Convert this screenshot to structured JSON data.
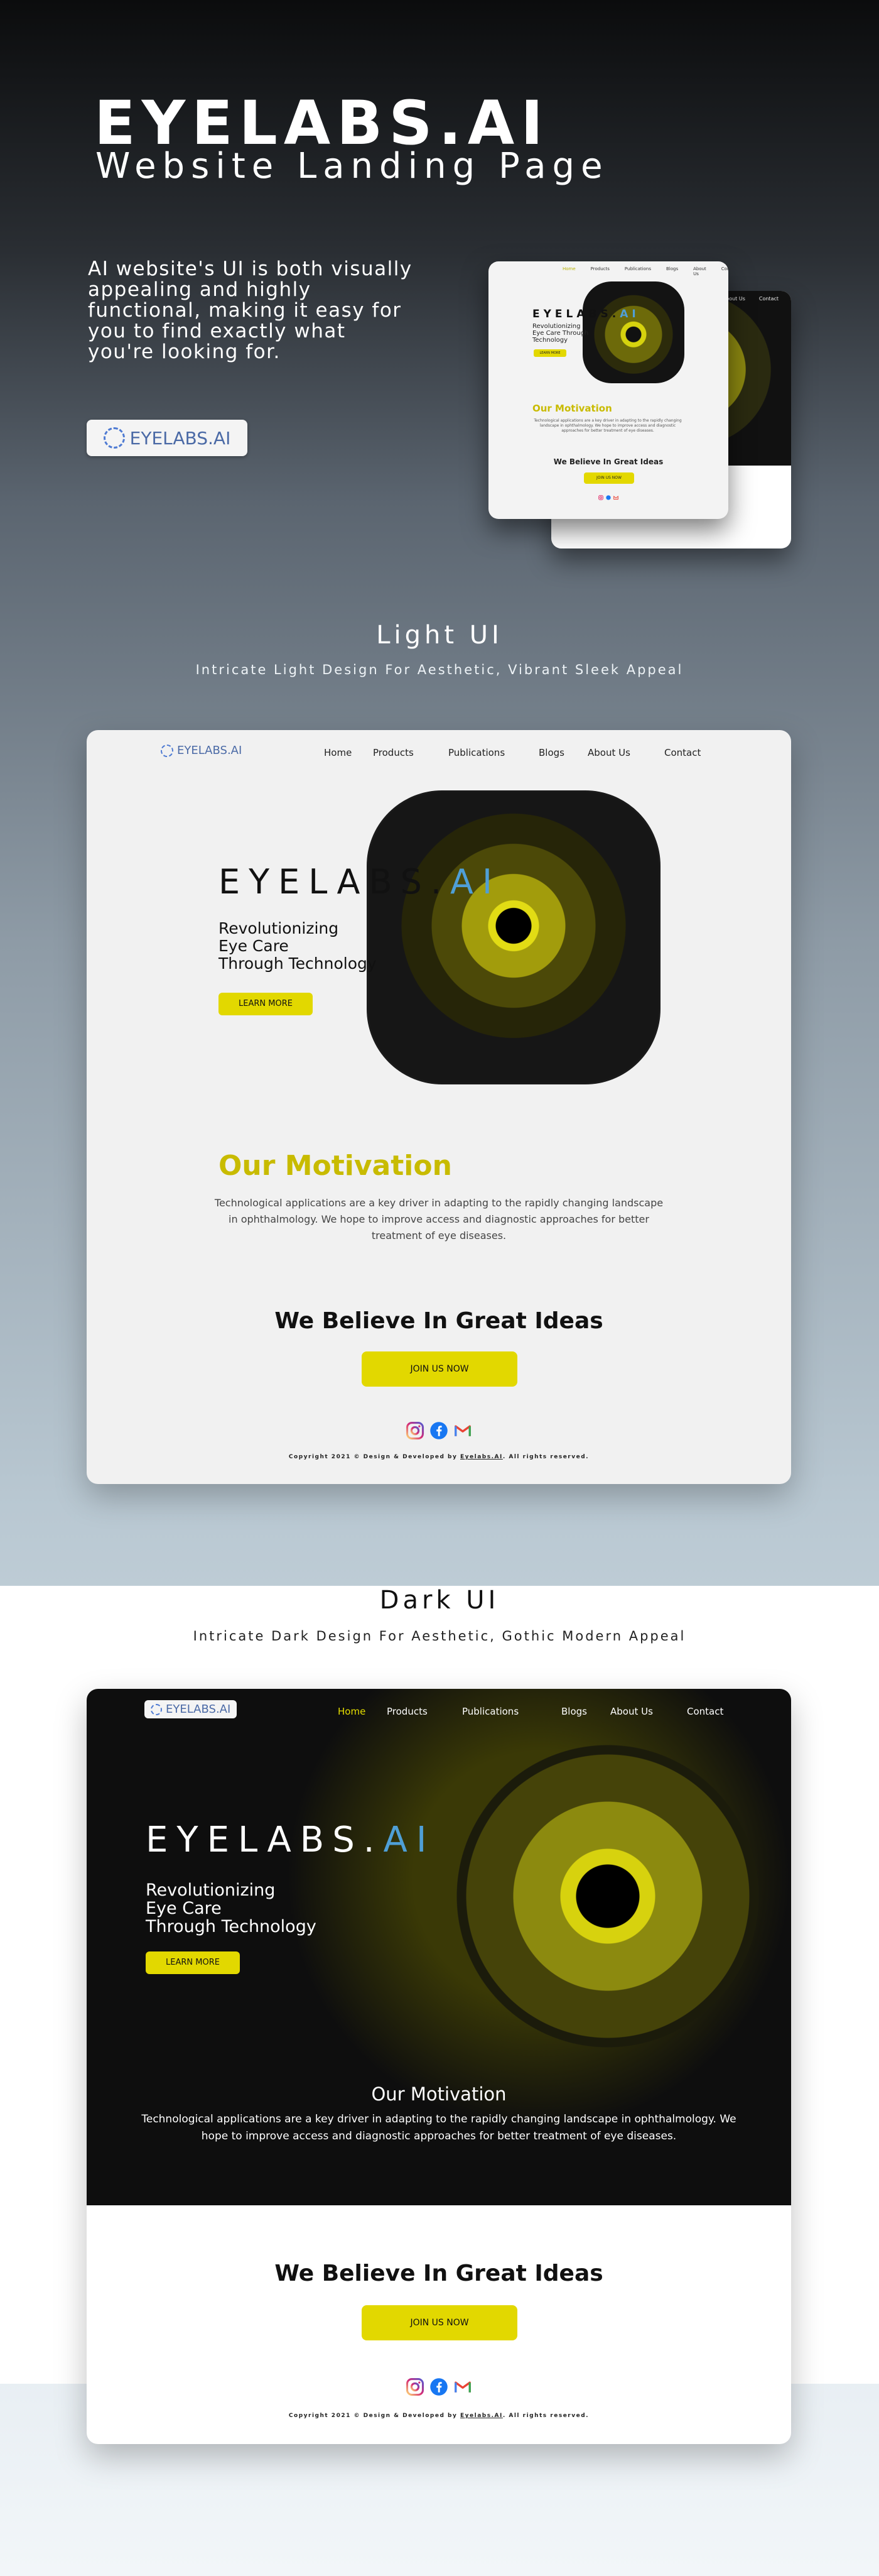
{
  "hero": {
    "title": "EYELABS.AI",
    "subtitle": "Website Landing Page",
    "description": "AI website's UI is both visually appealing and highly functional, making it easy for you to find exactly what you're looking for.",
    "logo_text": "EYELABS.AI"
  },
  "mockup": {
    "nav": [
      "Home",
      "Products",
      "Publications",
      "Blogs",
      "About Us",
      "Contact"
    ],
    "brand_main": "EYELABS.",
    "brand_ai": "AI",
    "tagline": "Revolutionizing Eye Care Through Technology",
    "learn_more": "LEARN MORE",
    "motivation": "Our Motivation",
    "motivation_text": "Technological applications are a key driver in adapting to the rapidly changing landscape in ophthalmology. We hope to improve access and diagnostic approaches for better treatment of eye diseases.",
    "ideas": "We Believe In Great Ideas",
    "join": "JOIN US NOW"
  },
  "light_section": {
    "title": "Light UI",
    "subtitle": "Intricate Light Design For Aesthetic, Vibrant Sleek Appeal"
  },
  "dark_section": {
    "title": "Dark UI",
    "subtitle": "Intricate Dark Design For Aesthetic, Gothic Modern Appeal"
  },
  "site": {
    "logo": "EYELABS.AI",
    "nav": {
      "home": "Home",
      "products": "Products",
      "publications": "Publications",
      "blogs": "Blogs",
      "about": "About Us",
      "contact": "Contact"
    },
    "brand_main": "EYELABS.",
    "brand_ai": "AI",
    "tagline_1": "Revolutionizing",
    "tagline_2": "Eye Care",
    "tagline_3": "Through Technology",
    "learn_more": "LEARN MORE",
    "motivation_title": "Our Motivation",
    "motivation_text": "Technological applications are a key driver in adapting to the rapidly changing landscape in ophthalmology. We hope to improve access and diagnostic approaches for better treatment of eye diseases.",
    "ideas_title": "We Believe In Great Ideas",
    "join_button": "JOIN US NOW",
    "copyright_prefix": "Copyright 2021 © Design & Developed by ",
    "copyright_link": "Eyelabs.AI",
    "copyright_suffix": ". All rights reserved."
  },
  "colors": {
    "accent_yellow": "#e2d800",
    "ai_blue": "#4f9fd6",
    "logo_blue": "#4b6aa6",
    "motivation_gold": "#c8bb00"
  },
  "icons": [
    "instagram-icon",
    "facebook-icon",
    "gmail-icon",
    "eyelabs-ring-icon"
  ]
}
